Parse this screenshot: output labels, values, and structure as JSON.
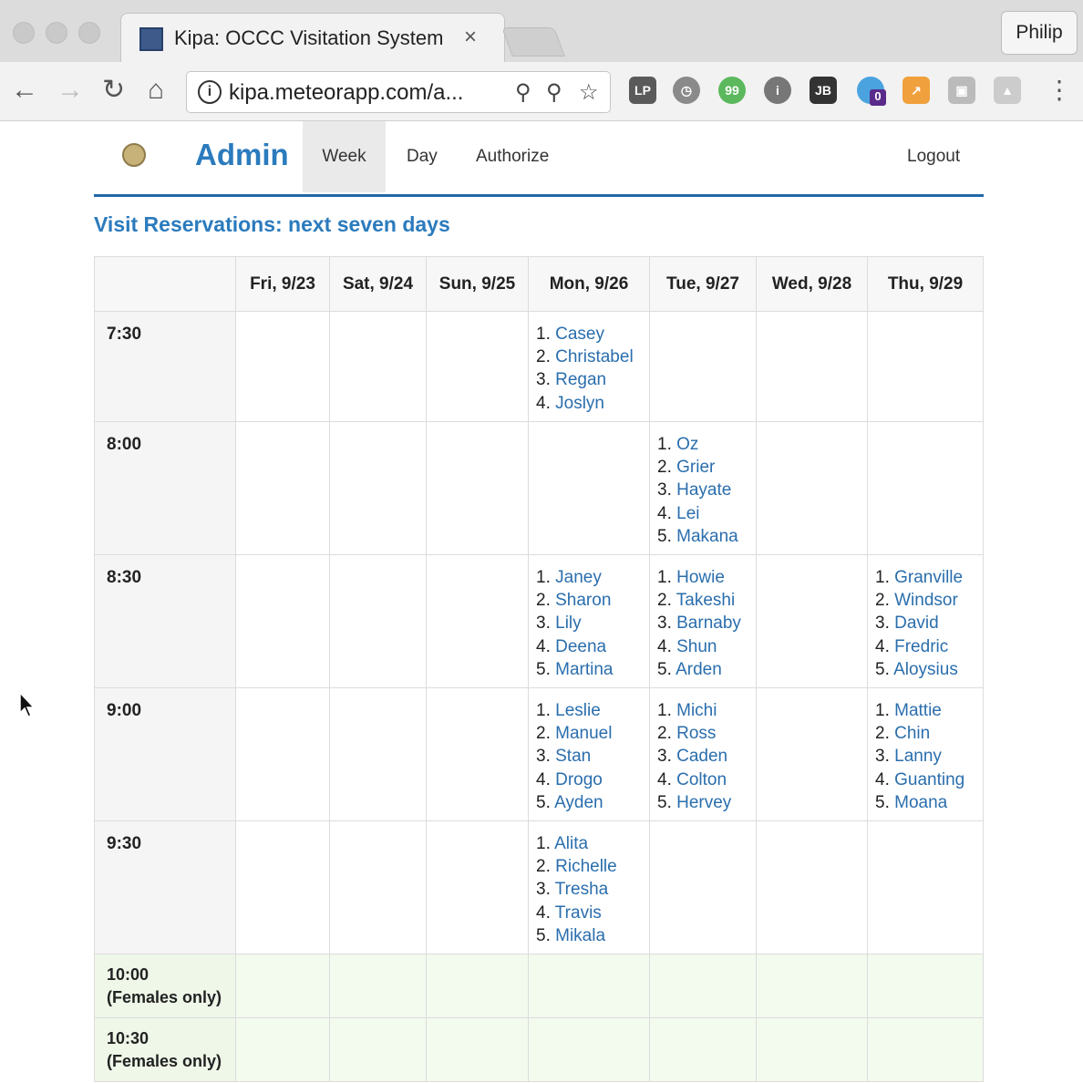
{
  "browser": {
    "tab_title": "Kipa: OCCC Visitation System",
    "tab_close": "×",
    "url": "kipa.meteorapp.com/a...",
    "profile_name": "Philip",
    "extensions": [
      "lastpass-icon",
      "clock-icon",
      "evernote-icon",
      "info-icon",
      "jetbrains-icon",
      "ghostery-icon",
      "chart-icon",
      "cube-icon",
      "drive-icon"
    ],
    "ghostery_count": "0"
  },
  "nav": {
    "brand": "Admin",
    "links": [
      "Week",
      "Day",
      "Authorize"
    ],
    "logout": "Logout"
  },
  "heading": "Visit Reservations: next seven days",
  "calendar": {
    "days": [
      "Fri, 9/23",
      "Sat, 9/24",
      "Sun, 9/25",
      "Mon, 9/26",
      "Tue, 9/27",
      "Wed, 9/28",
      "Thu, 9/29"
    ],
    "rows": [
      {
        "time": "7:30",
        "note": "",
        "height": 121,
        "cells": [
          [],
          [],
          [],
          [
            "Casey",
            "Christabel",
            "Regan",
            "Joslyn"
          ],
          [],
          [],
          []
        ]
      },
      {
        "time": "8:00",
        "note": "",
        "height": 146,
        "cells": [
          [],
          [],
          [],
          [],
          [
            "Oz",
            "Grier",
            "Hayate",
            "Lei",
            "Makana"
          ],
          [],
          []
        ]
      },
      {
        "time": "8:30",
        "note": "",
        "height": 146,
        "cells": [
          [],
          [],
          [],
          [
            "Janey",
            "Sharon",
            "Lily",
            "Deena",
            "Martina"
          ],
          [
            "Howie",
            "Takeshi",
            "Barnaby",
            "Shun",
            "Arden"
          ],
          [],
          [
            "Granville",
            "Windsor",
            "David",
            "Fredric",
            "Aloysius"
          ]
        ]
      },
      {
        "time": "9:00",
        "note": "",
        "height": 146,
        "cells": [
          [],
          [],
          [],
          [
            "Leslie",
            "Manuel",
            "Stan",
            "Drogo",
            "Ayden"
          ],
          [
            "Michi",
            "Ross",
            "Caden",
            "Colton",
            "Hervey"
          ],
          [],
          [
            "Mattie",
            "Chin",
            "Lanny",
            "Guanting",
            "Moana"
          ]
        ]
      },
      {
        "time": "9:30",
        "note": "",
        "height": 146,
        "cells": [
          [],
          [],
          [],
          [
            "Alita",
            "Richelle",
            "Tresha",
            "Travis",
            "Mikala"
          ],
          [],
          [],
          []
        ]
      },
      {
        "time": "10:00",
        "note": "(Females only)",
        "height": 70,
        "cells": [
          [],
          [],
          [],
          [],
          [],
          [],
          []
        ]
      },
      {
        "time": "10:30",
        "note": "(Females only)",
        "height": 70,
        "cells": [
          [],
          [],
          [],
          [],
          [],
          [],
          []
        ]
      }
    ]
  },
  "colors": {
    "accent": "#2b7bbd",
    "rule": "#2168a8",
    "female_row": "#f3faee"
  }
}
